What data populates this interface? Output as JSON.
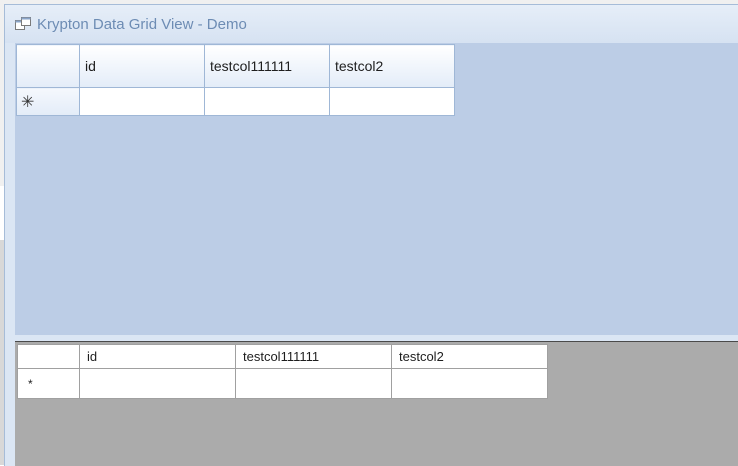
{
  "window": {
    "title": "Krypton Data Grid View - Demo",
    "icon": "application-window-icon"
  },
  "krypton_grid": {
    "columns": [
      "id",
      "testcol111111",
      "testcol2"
    ],
    "new_row_marker": "✳"
  },
  "standard_grid": {
    "columns": [
      "id",
      "testcol111111",
      "testcol2"
    ],
    "new_row_marker": "*"
  },
  "colors": {
    "upper_panel_background": "#bccde6",
    "lower_panel_background": "#ababab",
    "title_text": "#6d8cb4"
  }
}
